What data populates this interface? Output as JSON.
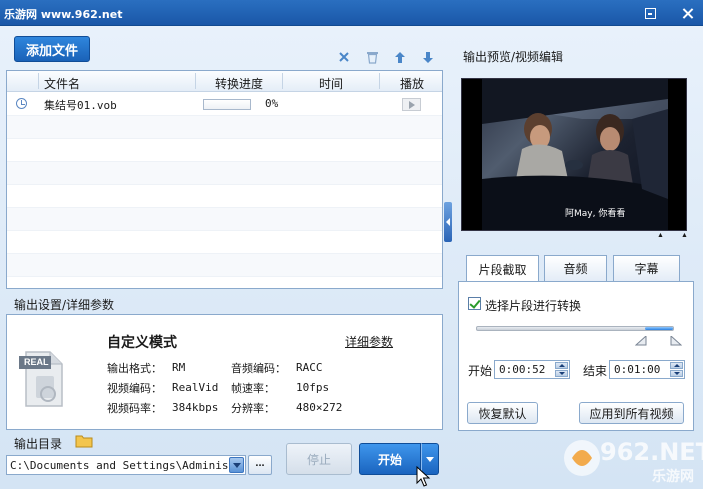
{
  "window": {
    "title": "乐游网 www.962.net"
  },
  "toolbar": {
    "add_file_label": "添加文件"
  },
  "file_table": {
    "headers": {
      "name": "文件名",
      "progress": "转换进度",
      "time": "时间",
      "play": "播放"
    },
    "rows": [
      {
        "name": "集结号01.vob",
        "progress_text": "0%",
        "progress_value": 0,
        "time": ""
      }
    ]
  },
  "output_settings": {
    "section_title": "输出设置/详细参数",
    "mode_title": "自定义模式",
    "detail_link": "详细参数",
    "doc_badge": "REAL",
    "params": {
      "output_format_label": "输出格式：",
      "output_format": "RM",
      "audio_codec_label": "音频编码：",
      "audio_codec": "RACC",
      "video_codec_label": "视频编码：",
      "video_codec": "RealVid",
      "frame_rate_label": "帧速率：",
      "frame_rate": "10fps",
      "video_bitrate_label": "视频码率：",
      "video_bitrate": "384kbps",
      "resolution_label": "分辨率：",
      "resolution": "480×272"
    }
  },
  "output_dir": {
    "label": "输出目录",
    "path": "C:\\Documents and Settings\\Administra",
    "browse_label": "..."
  },
  "actions": {
    "stop_label": "停止",
    "start_label": "开始"
  },
  "preview": {
    "section_title": "输出预览/视频编辑",
    "subtitle": "阿May, 你看看"
  },
  "edit_tabs": {
    "clip": "片段截取",
    "audio": "音频",
    "subtitle": "字幕",
    "active": "clip"
  },
  "clip": {
    "checkbox_label": "选择片段进行转换",
    "checked": true,
    "range_start_fraction": 0.86,
    "range_end_fraction": 1.0,
    "start_label": "开始",
    "start_value": "0:00:52",
    "end_label": "结束",
    "end_value": "0:01:00",
    "restore_label": "恢复默认",
    "apply_all_label": "应用到所有视频"
  },
  "watermark": {
    "logo": "962.NET",
    "sub": "乐游网"
  },
  "colors": {
    "titlebar": "#1a57a8",
    "accent": "#2a80e0",
    "panel_border": "#8aa9cc"
  }
}
